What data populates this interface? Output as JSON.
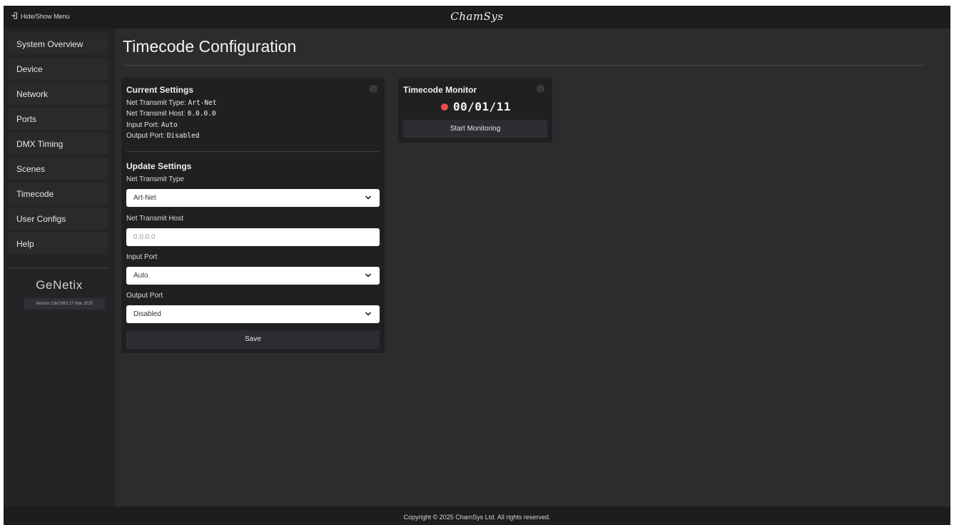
{
  "topbar": {
    "menu_toggle_label": "Hide/Show Menu",
    "brand": "ChamSys"
  },
  "sidebar": {
    "items": [
      {
        "label": "System Overview"
      },
      {
        "label": "Device"
      },
      {
        "label": "Network"
      },
      {
        "label": "Ports"
      },
      {
        "label": "DMX Timing"
      },
      {
        "label": "Scenes"
      },
      {
        "label": "Timecode"
      },
      {
        "label": "User Configs"
      },
      {
        "label": "Help"
      }
    ],
    "product_name": "GeNetix",
    "version": "Version 23e7d83 27 Mar 2025"
  },
  "main": {
    "title": "Timecode Configuration",
    "current_settings": {
      "heading": "Current Settings",
      "net_transmit_type_label": "Net Transmit Type:",
      "net_transmit_type_value": "Art-Net",
      "net_transmit_host_label": "Net Transmit Host:",
      "net_transmit_host_value": "0.0.0.0",
      "input_port_label": "Input Port:",
      "input_port_value": "Auto",
      "output_port_label": "Output Port:",
      "output_port_value": "Disabled"
    },
    "update_settings": {
      "heading": "Update Settings",
      "net_transmit_type_label": "Net Transmit Type",
      "net_transmit_type_selected": "Art-Net",
      "net_transmit_host_label": "Net Transmit Host",
      "net_transmit_host_placeholder": "0.0.0.0",
      "input_port_label": "Input Port",
      "input_port_selected": "Auto",
      "output_port_label": "Output Port",
      "output_port_selected": "Disabled",
      "save_label": "Save"
    },
    "monitor": {
      "heading": "Timecode Monitor",
      "timecode": "00/01/11",
      "start_label": "Start Monitoring"
    }
  },
  "footer": {
    "copyright": "Copyright © 2025 ChamSys Ltd.  All rights reserved."
  },
  "colors": {
    "background": "#2b2c2e",
    "bar": "#1c1d1f",
    "card": "#1f2022",
    "recording_dot": "#ee4b4b"
  },
  "icons": [
    "sign-in-icon",
    "help-icon",
    "clock-icon",
    "chevron-down-icon",
    "record-dot-icon"
  ]
}
